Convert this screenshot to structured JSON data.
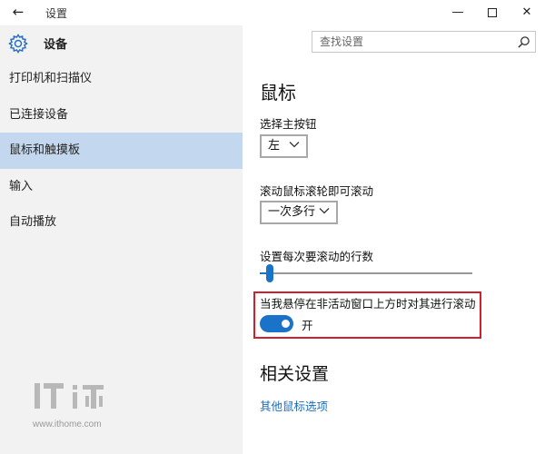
{
  "window": {
    "title": "设置",
    "back_glyph": "←",
    "minimize_glyph": "—",
    "close_glyph": "✕"
  },
  "sidebar": {
    "title": "设备",
    "items": [
      {
        "label": "打印机和扫描仪",
        "active": false
      },
      {
        "label": "已连接设备",
        "active": false
      },
      {
        "label": "鼠标和触摸板",
        "active": true
      },
      {
        "label": "输入",
        "active": false
      },
      {
        "label": "自动播放",
        "active": false
      }
    ]
  },
  "search": {
    "placeholder": "查找设置"
  },
  "main": {
    "page_title": "鼠标",
    "primary_button": {
      "label": "选择主按钮",
      "value": "左"
    },
    "scroll_wheel": {
      "label": "滚动鼠标滚轮即可滚动",
      "value": "一次多行"
    },
    "scroll_lines": {
      "label": "设置每次要滚动的行数",
      "level_fraction": 0.03
    },
    "inactive_scroll": {
      "label": "当我悬停在非活动窗口上方时对其进行滚动",
      "state_text": "开",
      "on": true
    },
    "related": {
      "title": "相关设置",
      "link": "其他鼠标选项"
    }
  },
  "watermark": {
    "url": "www.ithome.com"
  },
  "colors": {
    "accent": "#1a73c8",
    "sidebar_bg": "#f2f2f2",
    "selected_bg": "#c3d8ee",
    "highlight_border": "#d21f2e",
    "link": "#1a6ec0"
  }
}
